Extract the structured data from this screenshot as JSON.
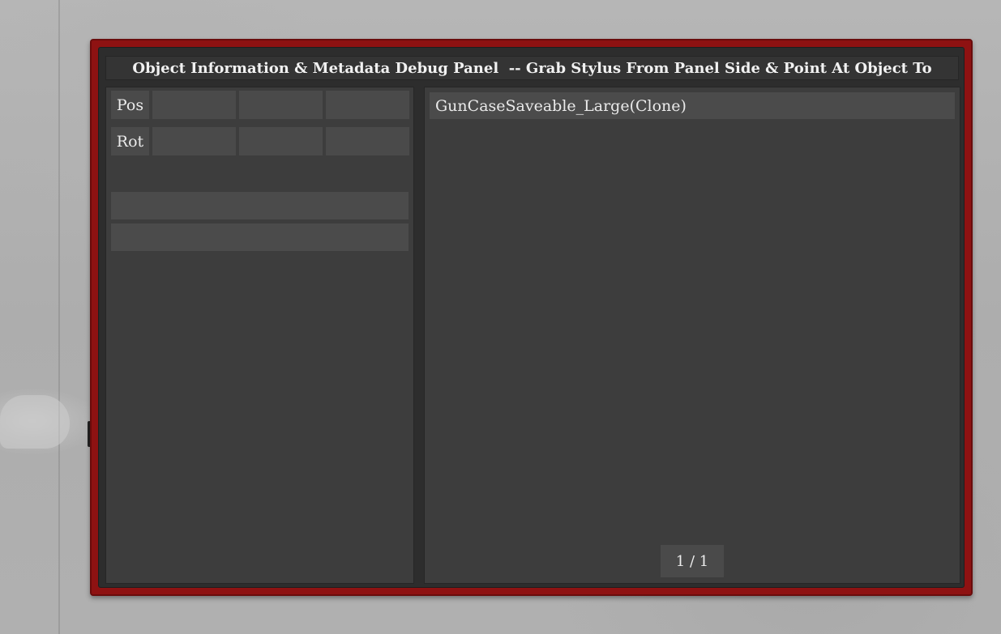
{
  "panel": {
    "title": "Object Information & Metadata Debug Panel  -- Grab Stylus From Panel Side & Point At Object To",
    "frame_color": "#8e1212",
    "background_color": "#3d3d3d"
  },
  "transform": {
    "position_label": "Pos",
    "rotation_label": "Rot",
    "position_values": [
      "",
      "",
      ""
    ],
    "rotation_values": [
      "",
      "",
      ""
    ]
  },
  "fields": {
    "field_1": "",
    "field_2": ""
  },
  "object_list": {
    "items": [
      "GunCaseSaveable_Large(Clone)"
    ],
    "page_indicator": "1 / 1"
  }
}
